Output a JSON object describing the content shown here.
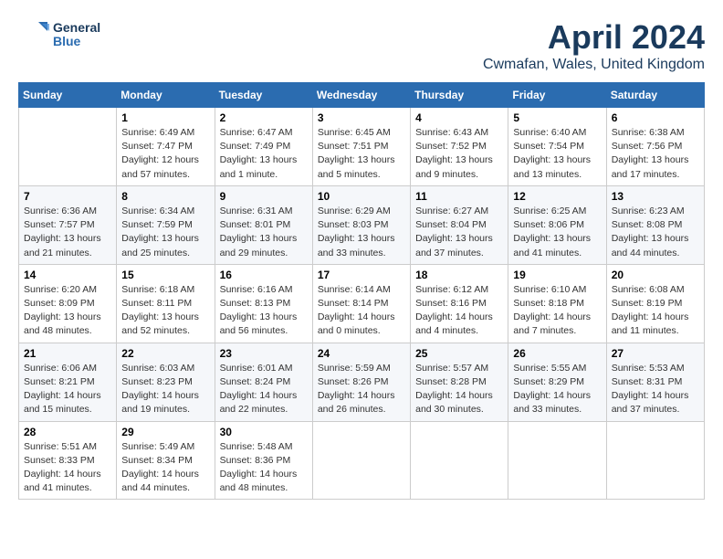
{
  "logo": {
    "text_general": "General",
    "text_blue": "Blue"
  },
  "title": "April 2024",
  "subtitle": "Cwmafan, Wales, United Kingdom",
  "days_of_week": [
    "Sunday",
    "Monday",
    "Tuesday",
    "Wednesday",
    "Thursday",
    "Friday",
    "Saturday"
  ],
  "weeks": [
    [
      {
        "day": "",
        "sunrise": "",
        "sunset": "",
        "daylight": ""
      },
      {
        "day": "1",
        "sunrise": "Sunrise: 6:49 AM",
        "sunset": "Sunset: 7:47 PM",
        "daylight": "Daylight: 12 hours and 57 minutes."
      },
      {
        "day": "2",
        "sunrise": "Sunrise: 6:47 AM",
        "sunset": "Sunset: 7:49 PM",
        "daylight": "Daylight: 13 hours and 1 minute."
      },
      {
        "day": "3",
        "sunrise": "Sunrise: 6:45 AM",
        "sunset": "Sunset: 7:51 PM",
        "daylight": "Daylight: 13 hours and 5 minutes."
      },
      {
        "day": "4",
        "sunrise": "Sunrise: 6:43 AM",
        "sunset": "Sunset: 7:52 PM",
        "daylight": "Daylight: 13 hours and 9 minutes."
      },
      {
        "day": "5",
        "sunrise": "Sunrise: 6:40 AM",
        "sunset": "Sunset: 7:54 PM",
        "daylight": "Daylight: 13 hours and 13 minutes."
      },
      {
        "day": "6",
        "sunrise": "Sunrise: 6:38 AM",
        "sunset": "Sunset: 7:56 PM",
        "daylight": "Daylight: 13 hours and 17 minutes."
      }
    ],
    [
      {
        "day": "7",
        "sunrise": "Sunrise: 6:36 AM",
        "sunset": "Sunset: 7:57 PM",
        "daylight": "Daylight: 13 hours and 21 minutes."
      },
      {
        "day": "8",
        "sunrise": "Sunrise: 6:34 AM",
        "sunset": "Sunset: 7:59 PM",
        "daylight": "Daylight: 13 hours and 25 minutes."
      },
      {
        "day": "9",
        "sunrise": "Sunrise: 6:31 AM",
        "sunset": "Sunset: 8:01 PM",
        "daylight": "Daylight: 13 hours and 29 minutes."
      },
      {
        "day": "10",
        "sunrise": "Sunrise: 6:29 AM",
        "sunset": "Sunset: 8:03 PM",
        "daylight": "Daylight: 13 hours and 33 minutes."
      },
      {
        "day": "11",
        "sunrise": "Sunrise: 6:27 AM",
        "sunset": "Sunset: 8:04 PM",
        "daylight": "Daylight: 13 hours and 37 minutes."
      },
      {
        "day": "12",
        "sunrise": "Sunrise: 6:25 AM",
        "sunset": "Sunset: 8:06 PM",
        "daylight": "Daylight: 13 hours and 41 minutes."
      },
      {
        "day": "13",
        "sunrise": "Sunrise: 6:23 AM",
        "sunset": "Sunset: 8:08 PM",
        "daylight": "Daylight: 13 hours and 44 minutes."
      }
    ],
    [
      {
        "day": "14",
        "sunrise": "Sunrise: 6:20 AM",
        "sunset": "Sunset: 8:09 PM",
        "daylight": "Daylight: 13 hours and 48 minutes."
      },
      {
        "day": "15",
        "sunrise": "Sunrise: 6:18 AM",
        "sunset": "Sunset: 8:11 PM",
        "daylight": "Daylight: 13 hours and 52 minutes."
      },
      {
        "day": "16",
        "sunrise": "Sunrise: 6:16 AM",
        "sunset": "Sunset: 8:13 PM",
        "daylight": "Daylight: 13 hours and 56 minutes."
      },
      {
        "day": "17",
        "sunrise": "Sunrise: 6:14 AM",
        "sunset": "Sunset: 8:14 PM",
        "daylight": "Daylight: 14 hours and 0 minutes."
      },
      {
        "day": "18",
        "sunrise": "Sunrise: 6:12 AM",
        "sunset": "Sunset: 8:16 PM",
        "daylight": "Daylight: 14 hours and 4 minutes."
      },
      {
        "day": "19",
        "sunrise": "Sunrise: 6:10 AM",
        "sunset": "Sunset: 8:18 PM",
        "daylight": "Daylight: 14 hours and 7 minutes."
      },
      {
        "day": "20",
        "sunrise": "Sunrise: 6:08 AM",
        "sunset": "Sunset: 8:19 PM",
        "daylight": "Daylight: 14 hours and 11 minutes."
      }
    ],
    [
      {
        "day": "21",
        "sunrise": "Sunrise: 6:06 AM",
        "sunset": "Sunset: 8:21 PM",
        "daylight": "Daylight: 14 hours and 15 minutes."
      },
      {
        "day": "22",
        "sunrise": "Sunrise: 6:03 AM",
        "sunset": "Sunset: 8:23 PM",
        "daylight": "Daylight: 14 hours and 19 minutes."
      },
      {
        "day": "23",
        "sunrise": "Sunrise: 6:01 AM",
        "sunset": "Sunset: 8:24 PM",
        "daylight": "Daylight: 14 hours and 22 minutes."
      },
      {
        "day": "24",
        "sunrise": "Sunrise: 5:59 AM",
        "sunset": "Sunset: 8:26 PM",
        "daylight": "Daylight: 14 hours and 26 minutes."
      },
      {
        "day": "25",
        "sunrise": "Sunrise: 5:57 AM",
        "sunset": "Sunset: 8:28 PM",
        "daylight": "Daylight: 14 hours and 30 minutes."
      },
      {
        "day": "26",
        "sunrise": "Sunrise: 5:55 AM",
        "sunset": "Sunset: 8:29 PM",
        "daylight": "Daylight: 14 hours and 33 minutes."
      },
      {
        "day": "27",
        "sunrise": "Sunrise: 5:53 AM",
        "sunset": "Sunset: 8:31 PM",
        "daylight": "Daylight: 14 hours and 37 minutes."
      }
    ],
    [
      {
        "day": "28",
        "sunrise": "Sunrise: 5:51 AM",
        "sunset": "Sunset: 8:33 PM",
        "daylight": "Daylight: 14 hours and 41 minutes."
      },
      {
        "day": "29",
        "sunrise": "Sunrise: 5:49 AM",
        "sunset": "Sunset: 8:34 PM",
        "daylight": "Daylight: 14 hours and 44 minutes."
      },
      {
        "day": "30",
        "sunrise": "Sunrise: 5:48 AM",
        "sunset": "Sunset: 8:36 PM",
        "daylight": "Daylight: 14 hours and 48 minutes."
      },
      {
        "day": "",
        "sunrise": "",
        "sunset": "",
        "daylight": ""
      },
      {
        "day": "",
        "sunrise": "",
        "sunset": "",
        "daylight": ""
      },
      {
        "day": "",
        "sunrise": "",
        "sunset": "",
        "daylight": ""
      },
      {
        "day": "",
        "sunrise": "",
        "sunset": "",
        "daylight": ""
      }
    ]
  ]
}
